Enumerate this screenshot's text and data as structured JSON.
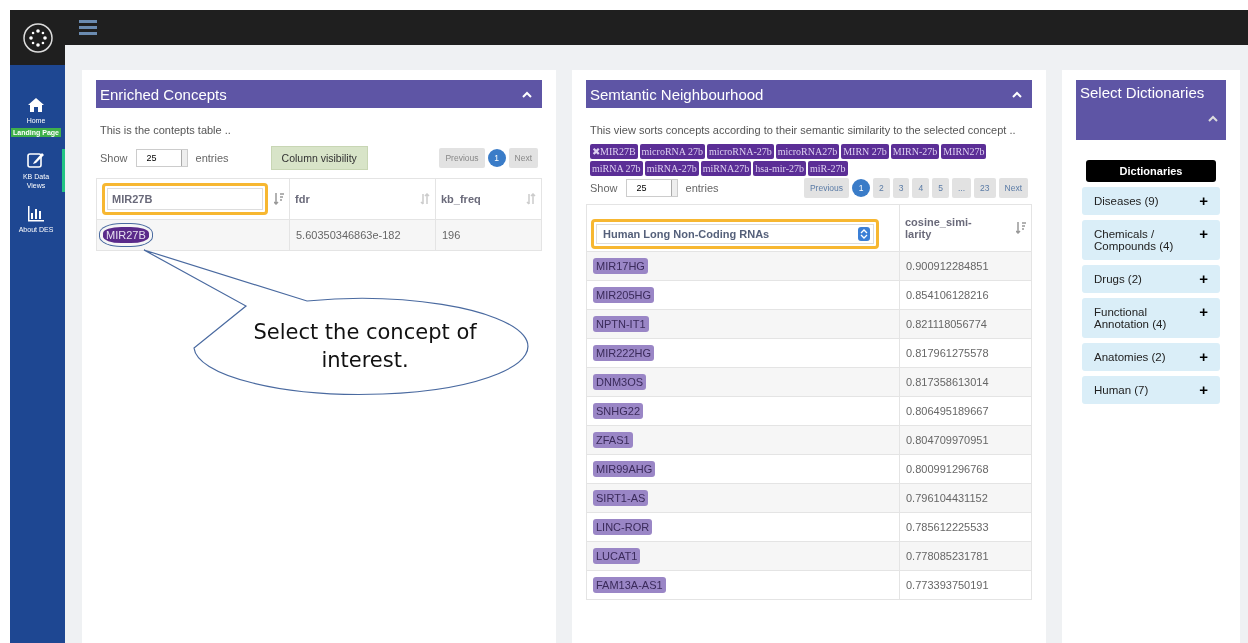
{
  "sidebar": {
    "items": [
      {
        "label": "Home",
        "kind": "home",
        "badge": "Landing Page",
        "selected": false
      },
      {
        "label": "KB Data Views",
        "kind": "edit",
        "selected": true
      },
      {
        "label": "About DES",
        "kind": "chart",
        "selected": false
      }
    ]
  },
  "enriched_concepts": {
    "title": "Enriched Concepts",
    "description": "This is the contepts table ..",
    "show_label": "Show",
    "page_size": "25",
    "entries_label": "entries",
    "column_visibility": "Column visibility",
    "pager": [
      {
        "label": "Previous",
        "selected": false
      },
      {
        "label": "1",
        "selected": true
      },
      {
        "label": "Next",
        "selected": false
      }
    ],
    "filter": {
      "value": "MIR27B",
      "highlighted": true
    },
    "columns": [
      "fdr",
      "kb_freq"
    ],
    "rows": [
      {
        "concept": "MIR27B",
        "circled": true,
        "fdr": "5.60350346863e-182",
        "kb_freq": "196"
      }
    ]
  },
  "callout": {
    "text": "Select the concept of interest."
  },
  "semantic_neighbourhood": {
    "title": "Semtantic Neighbourhood",
    "description": "This view sorts concepts according to their semantic similarity to the selected concept ..",
    "synonyms": [
      "✖MIR27B",
      "microRNA 27b",
      "microRNA-27b",
      "microRNA27b",
      "MIRN 27b",
      "MIRN-27b",
      "MIRN27b",
      "miRNA 27b",
      "miRNA-27b",
      "miRNA27b",
      "hsa-mir-27b",
      "miR-27b"
    ],
    "show_label": "Show",
    "page_size": "25",
    "entries_label": "entries",
    "pager": [
      {
        "label": "Previous",
        "selected": false
      },
      {
        "label": "1",
        "selected": true
      },
      {
        "label": "2",
        "selected": false
      },
      {
        "label": "3",
        "selected": false
      },
      {
        "label": "4",
        "selected": false
      },
      {
        "label": "5",
        "selected": false
      },
      {
        "label": "...",
        "selected": false
      },
      {
        "label": "23",
        "selected": false
      },
      {
        "label": "Next",
        "selected": false
      }
    ],
    "filter_select": {
      "value": "Human Long Non-Coding RNAs",
      "highlighted": true
    },
    "score_column": "cosine_simi-larity",
    "rows": [
      {
        "concept": "MIR17HG",
        "score": "0.900912284851"
      },
      {
        "concept": "MIR205HG",
        "score": "0.854106128216"
      },
      {
        "concept": "NPTN-IT1",
        "score": "0.821118056774"
      },
      {
        "concept": "MIR222HG",
        "score": "0.817961275578"
      },
      {
        "concept": "DNM3OS",
        "score": "0.817358613014"
      },
      {
        "concept": "SNHG22",
        "score": "0.806495189667"
      },
      {
        "concept": "ZFAS1",
        "score": "0.804709970951"
      },
      {
        "concept": "MIR99AHG",
        "score": "0.800991296768"
      },
      {
        "concept": "SIRT1-AS",
        "score": "0.796104431152"
      },
      {
        "concept": "LINC-ROR",
        "score": "0.785612225533"
      },
      {
        "concept": "LUCAT1",
        "score": "0.778085231781"
      },
      {
        "concept": "FAM13A-AS1",
        "score": "0.773393750191"
      }
    ]
  },
  "select_dictionaries": {
    "title": "Select Dictionaries",
    "heading": "Dictionaries",
    "items": [
      {
        "label": "Diseases (9)",
        "expand": "+"
      },
      {
        "label": "Chemicals / Compounds (4)",
        "expand": "+"
      },
      {
        "label": "Drugs (2)",
        "expand": "+"
      },
      {
        "label": "Functional Annotation (4)",
        "expand": "+"
      },
      {
        "label": "Anatomies (2)",
        "expand": "+"
      },
      {
        "label": "Human (7)",
        "expand": "+"
      }
    ]
  }
}
